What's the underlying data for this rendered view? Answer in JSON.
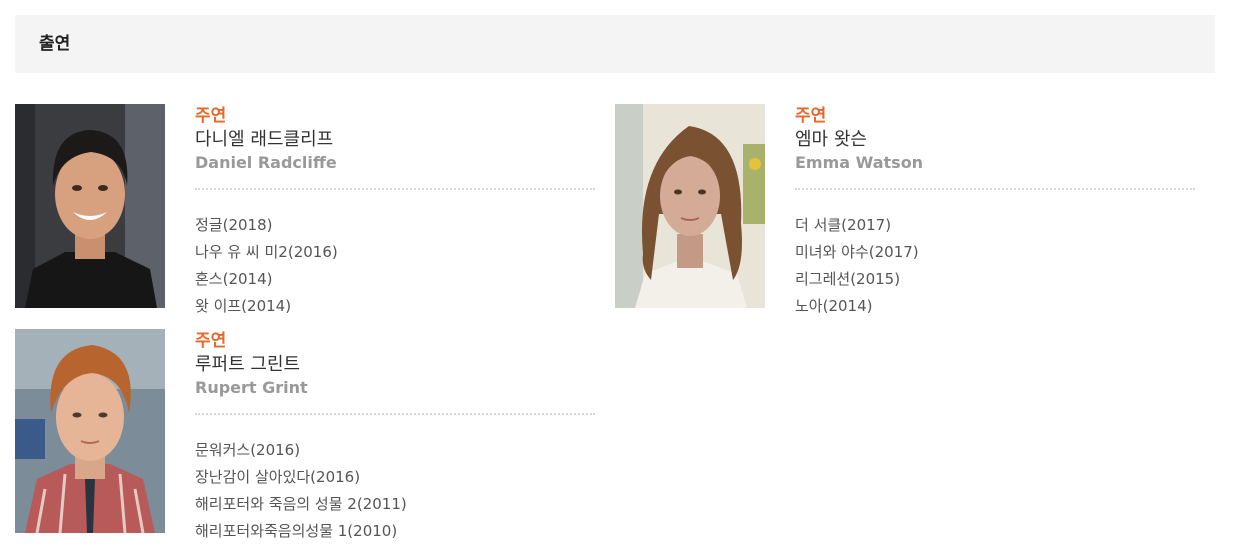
{
  "section": {
    "title": "출연"
  },
  "cast": [
    {
      "role": "주연",
      "name_ko": "다니엘 래드클리프",
      "name_en": "Daniel Radcliffe",
      "films": [
        "정글(2018)",
        "나우 유 씨 미2(2016)",
        "혼스(2014)",
        "왓 이프(2014)"
      ]
    },
    {
      "role": "주연",
      "name_ko": "엠마 왓슨",
      "name_en": "Emma Watson",
      "films": [
        "더 서클(2017)",
        "미녀와 야수(2017)",
        "리그레션(2015)",
        "노아(2014)"
      ]
    },
    {
      "role": "주연",
      "name_ko": "루퍼트 그린트",
      "name_en": "Rupert Grint",
      "films": [
        "문워커스(2016)",
        "장난감이 살아있다(2016)",
        "해리포터와 죽음의 성물 2(2011)",
        "해리포터와죽음의성물 1(2010)"
      ]
    }
  ],
  "colors": {
    "role": "#e8682a",
    "header_bg": "#f4f4f4",
    "name_en": "#999999"
  }
}
